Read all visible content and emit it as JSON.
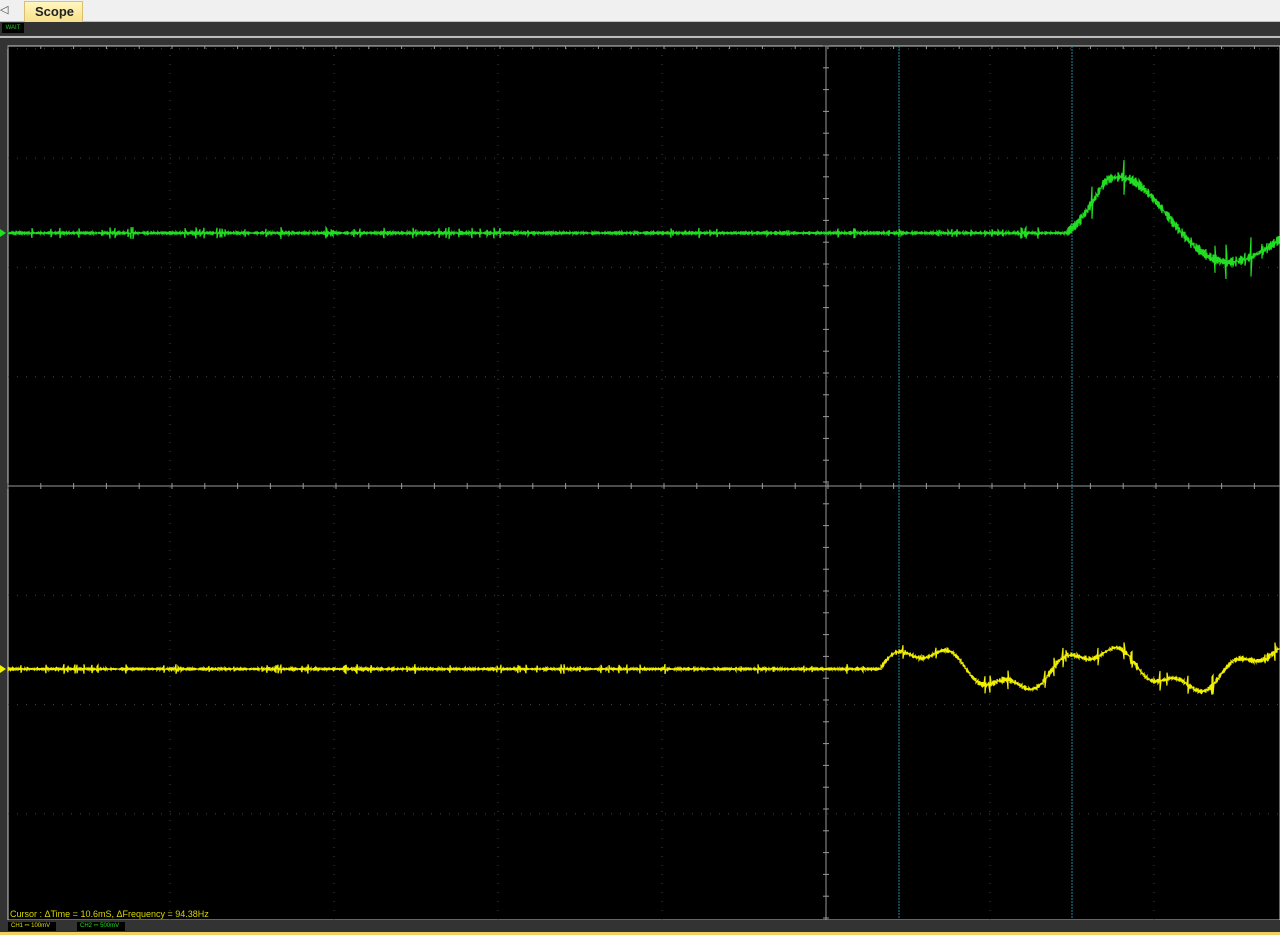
{
  "tab": {
    "label": "Scope"
  },
  "status": {
    "state": "WAIT"
  },
  "cursor": {
    "label": "Cursor : ΔTime = 10.6mS, ΔFrequency = 94.38Hz"
  },
  "channels": [
    {
      "label": "CH1 ⎓  100mV",
      "color": "#f0f000"
    },
    {
      "label": "CH2 ⎓  500mV",
      "color": "#22dd22"
    }
  ]
}
